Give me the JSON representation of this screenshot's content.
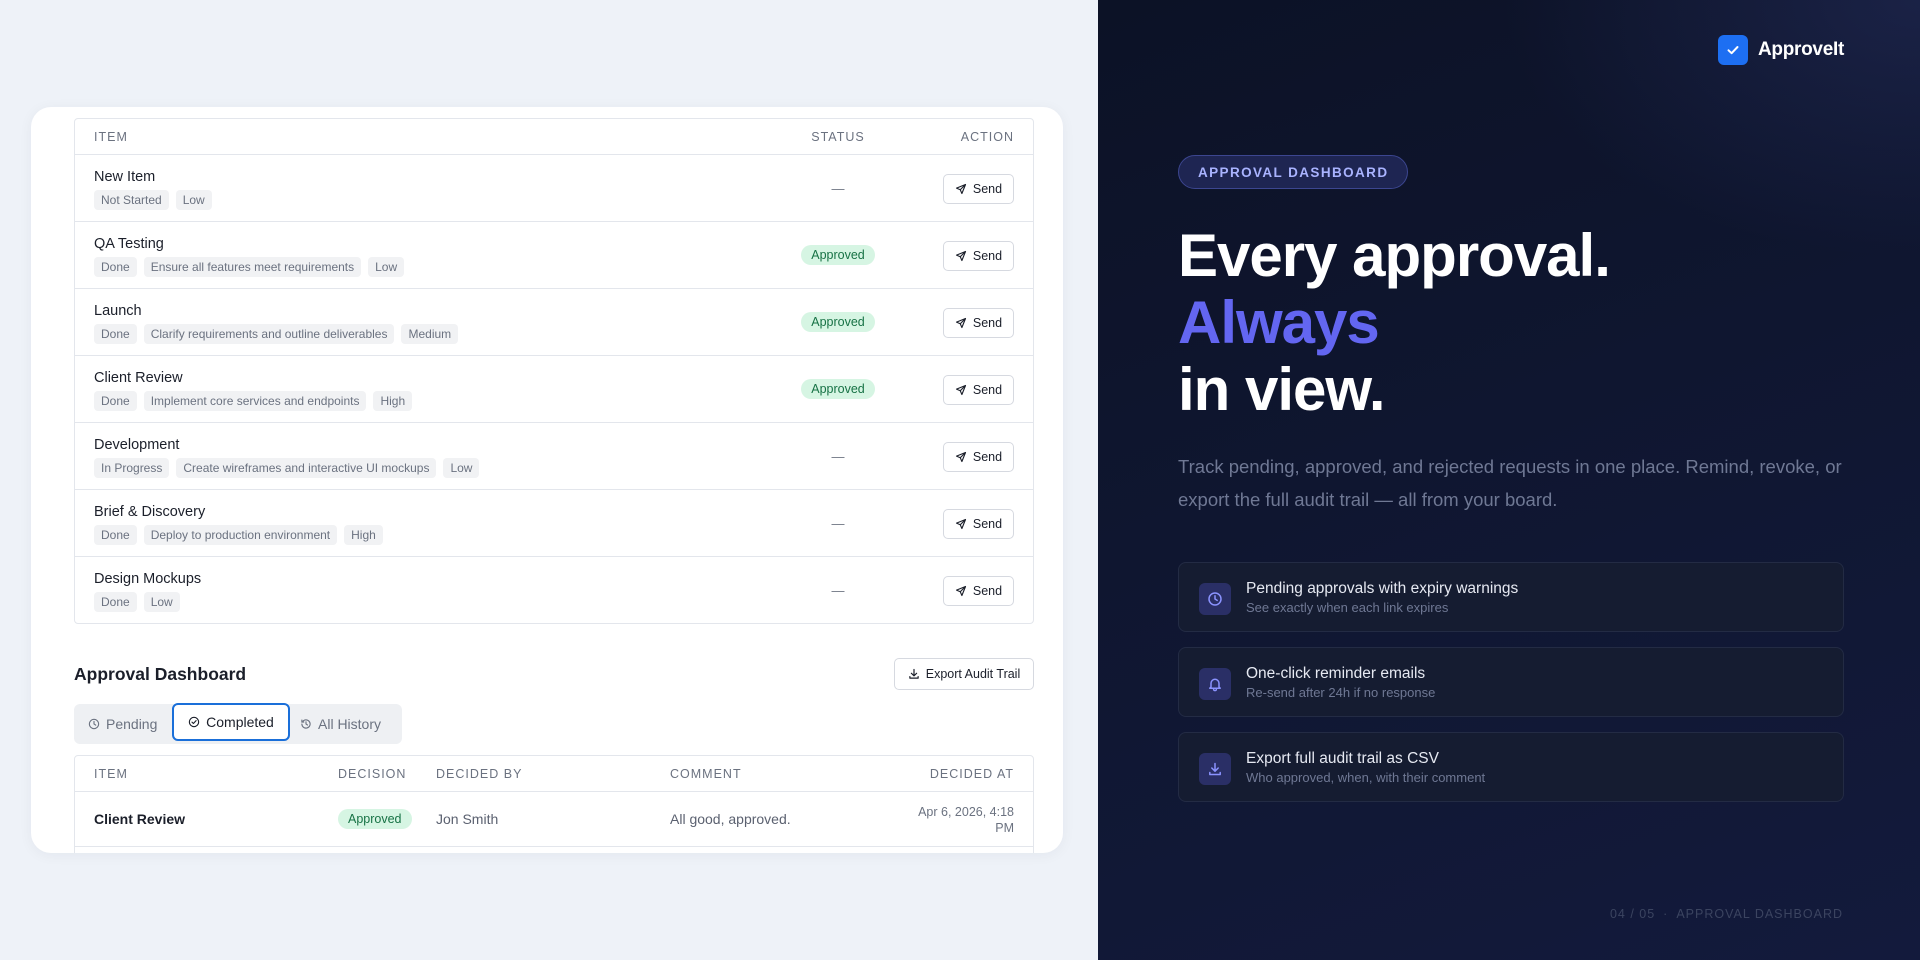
{
  "items_table": {
    "headers": {
      "item": "ITEM",
      "status": "STATUS",
      "action": "ACTION"
    },
    "send_label": "Send",
    "rows": [
      {
        "title": "New Item",
        "tags": [
          "Not Started",
          "Low"
        ],
        "status": "—",
        "approved": false
      },
      {
        "title": "QA Testing",
        "tags": [
          "Done",
          "Ensure all features meet requirements",
          "Low"
        ],
        "status": "Approved",
        "approved": true
      },
      {
        "title": "Launch",
        "tags": [
          "Done",
          "Clarify requirements and outline deliverables",
          "Medium"
        ],
        "status": "Approved",
        "approved": true
      },
      {
        "title": "Client Review",
        "tags": [
          "Done",
          "Implement core services and endpoints",
          "High"
        ],
        "status": "Approved",
        "approved": true
      },
      {
        "title": "Development",
        "tags": [
          "In Progress",
          "Create wireframes and interactive UI mockups",
          "Low"
        ],
        "status": "—",
        "approved": false
      },
      {
        "title": "Brief & Discovery",
        "tags": [
          "Done",
          "Deploy to production environment",
          "High"
        ],
        "status": "—",
        "approved": false
      },
      {
        "title": "Design Mockups",
        "tags": [
          "Done",
          "Low"
        ],
        "status": "—",
        "approved": false
      }
    ]
  },
  "dashboard": {
    "title": "Approval Dashboard",
    "export_label": "Export Audit Trail",
    "tabs": {
      "pending": "Pending",
      "completed": "Completed",
      "history": "All History"
    },
    "history": {
      "headers": {
        "item": "ITEM",
        "decision": "DECISION",
        "decided_by": "DECIDED BY",
        "comment": "COMMENT",
        "decided_at": "DECIDED AT"
      },
      "rows": [
        {
          "item": "Client Review",
          "decision": "Approved",
          "decided_by": "Jon Smith",
          "comment": "All good, approved.",
          "decided_at": "Apr 6, 2026, 4:18 PM"
        }
      ]
    }
  },
  "hero": {
    "brand": "ApproveIt",
    "pill": "APPROVAL DASHBOARD",
    "headline_1": "Every approval.",
    "headline_2": "Always",
    "headline_3": "in view.",
    "sub": "Track pending, approved, and rejected requests in one place. Remind, revoke, or export the full audit trail — all from your board.",
    "features": [
      {
        "icon": "clock-icon",
        "title": "Pending approvals with expiry warnings",
        "desc": "See exactly when each link expires"
      },
      {
        "icon": "bell-icon",
        "title": "One-click reminder emails",
        "desc": "Re-send after 24h if no response"
      },
      {
        "icon": "download-icon",
        "title": "Export full audit trail as CSV",
        "desc": "Who approved, when, with their comment"
      }
    ],
    "footer_page": "04 / 05",
    "footer_sep": "·",
    "footer_label": "APPROVAL DASHBOARD"
  },
  "colors": {
    "accent": "#6366f1",
    "brand_blue": "#1d6ff2",
    "approved_bg": "#d6f5e3",
    "approved_text": "#177245",
    "tab_focus": "#1a6fd9"
  }
}
